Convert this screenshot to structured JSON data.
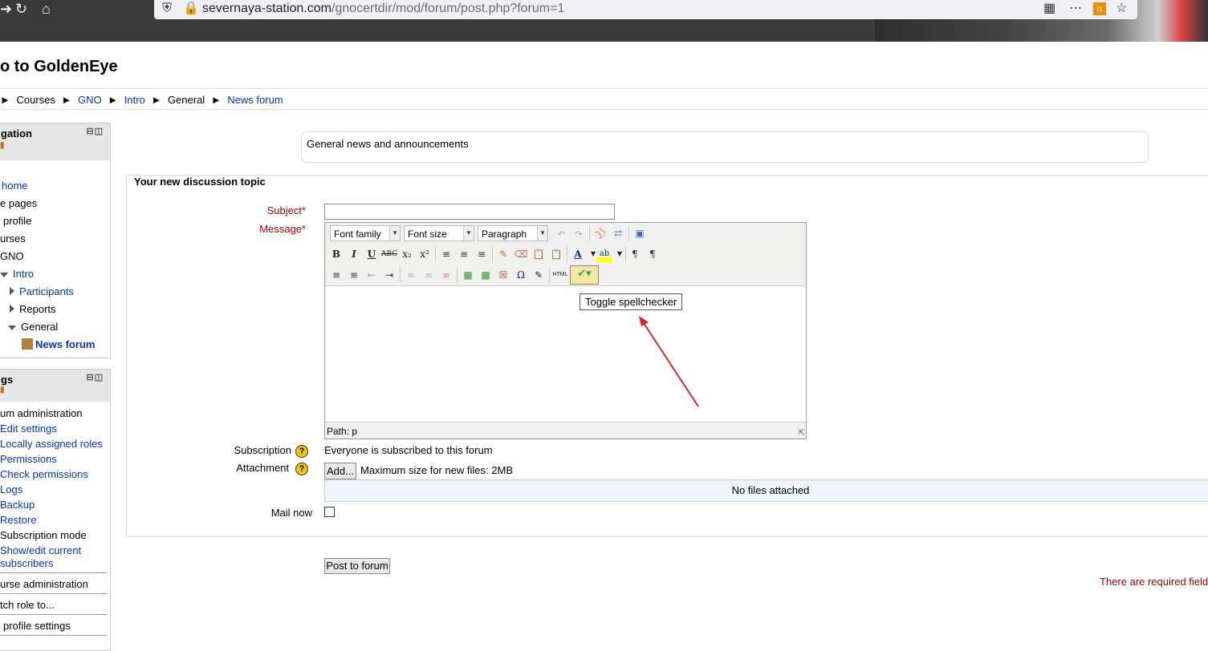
{
  "browser": {
    "url_domain": "severnaya-station.com",
    "url_path": "/gnocertdir/mod/forum/post.php?forum=1"
  },
  "site": {
    "title": "o to GoldenEye"
  },
  "breadcrumb": {
    "items": [
      {
        "label": "Courses"
      },
      {
        "label": "GNO"
      },
      {
        "label": "Intro"
      },
      {
        "label": "General"
      },
      {
        "label": "News forum"
      }
    ]
  },
  "navigation": {
    "title": "gation",
    "items": [
      {
        "label": "home"
      },
      {
        "label": "e pages"
      },
      {
        "label": "profile"
      },
      {
        "label": "urses"
      },
      {
        "label": "GNO"
      },
      {
        "label": "Intro"
      },
      {
        "label": "Participants"
      },
      {
        "label": "Reports"
      },
      {
        "label": "General"
      },
      {
        "label": "News forum"
      }
    ]
  },
  "settings": {
    "title": "gs",
    "items": [
      {
        "label": "um administration"
      },
      {
        "label": "Edit settings"
      },
      {
        "label": "Locally assigned roles"
      },
      {
        "label": "Permissions"
      },
      {
        "label": "Check permissions"
      },
      {
        "label": "Logs"
      },
      {
        "label": "Backup"
      },
      {
        "label": "Restore"
      },
      {
        "label": "Subscription mode"
      },
      {
        "label": "Show/edit current"
      },
      {
        "label": "subscribers"
      },
      {
        "label": "urse administration"
      },
      {
        "label": "tch role to..."
      },
      {
        "label": "profile settings"
      }
    ]
  },
  "forum": {
    "intro": "General news and announcements"
  },
  "form": {
    "legend": "Your new discussion topic",
    "subject_label": "Subject",
    "message_label": "Message",
    "required_mark": "*",
    "subject_value": "",
    "subscription_label": "Subscription",
    "subscription_value": "Everyone is subscribed to this forum",
    "attachment_label": "Attachment",
    "add_button": "Add...",
    "max_size": "Maximum size for new files: 2MB",
    "no_files": "No files attached",
    "mailnow_label": "Mail now",
    "submit_label": "Post to forum",
    "required_note": "There are required fields"
  },
  "editor": {
    "font_family": "Font family",
    "font_size": "Font size",
    "format": "Paragraph",
    "path": "Path: p",
    "tooltip": "Toggle spellchecker"
  },
  "icons": {
    "help": "?"
  },
  "colors": {
    "link": "#0033cc",
    "required": "#aa0000",
    "annotation_arrow": "#d9252a"
  }
}
